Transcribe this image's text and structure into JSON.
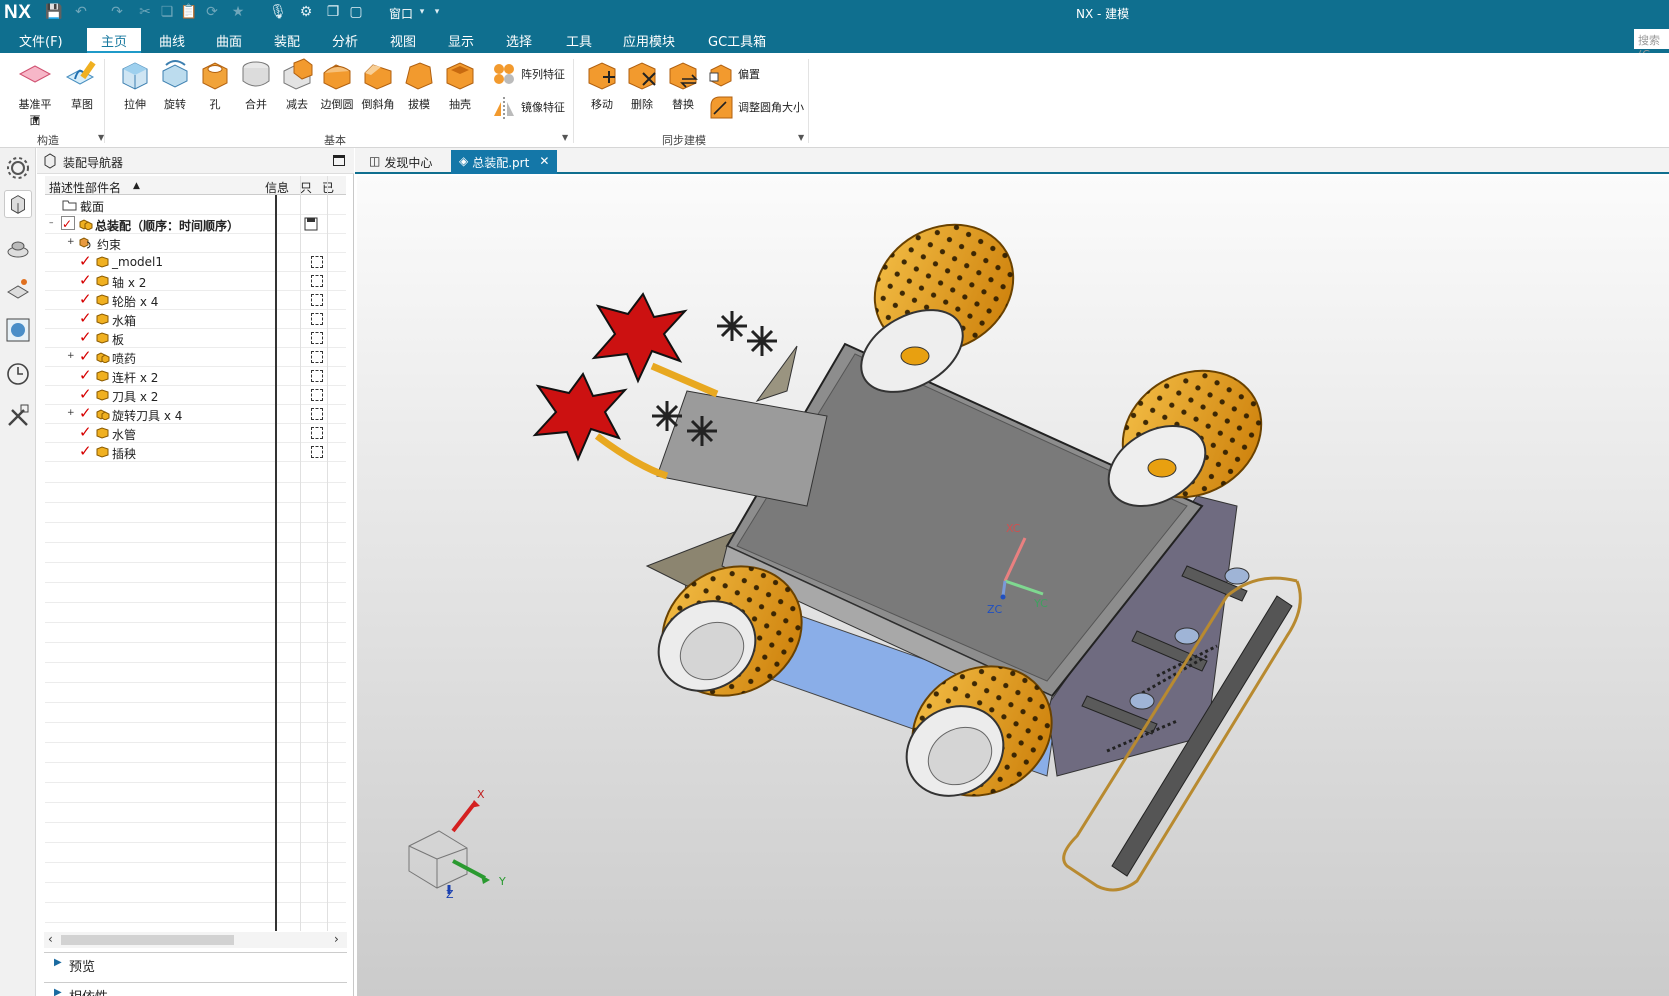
{
  "titlebar": {
    "logo": "NX",
    "window_menu": "窗口",
    "title": "NX - 建模"
  },
  "menubar": {
    "items": [
      "文件(F)",
      "主页",
      "曲线",
      "曲面",
      "装配",
      "分析",
      "视图",
      "显示",
      "选择",
      "工具",
      "应用模块",
      "GC工具箱"
    ],
    "active": "主页",
    "search_placeholder": "搜索 (C"
  },
  "ribbon": {
    "construct": {
      "datum_plane": "基准平面",
      "sketch": "草图",
      "group": "构造"
    },
    "basic": {
      "extrude": "拉伸",
      "revolve": "旋转",
      "hole": "孔",
      "unite": "合并",
      "subtract": "减去",
      "edge_blend": "边倒圆",
      "chamfer": "倒斜角",
      "draft": "拔模",
      "shell": "抽壳",
      "pattern_feature": "阵列特征",
      "mirror_feature": "镜像特征",
      "group": "基本"
    },
    "sync": {
      "move": "移动",
      "delete": "删除",
      "replace": "替换",
      "offset": "偏置",
      "resize_blend": "调整圆角大小",
      "group": "同步建模"
    }
  },
  "navigator": {
    "title": "装配导航器",
    "columns": {
      "name": "描述性部件名",
      "info": "信息",
      "readonly": "只",
      "extra": "已"
    },
    "rows": [
      {
        "label": "截面",
        "type": "folder"
      },
      {
        "label": "总装配（顺序：时间顺序）",
        "type": "root"
      },
      {
        "label": "约束",
        "type": "constraints"
      },
      {
        "label": "_model1"
      },
      {
        "label": "轴 x 2"
      },
      {
        "label": "轮胎 x 4"
      },
      {
        "label": "水箱"
      },
      {
        "label": "板"
      },
      {
        "label": "喷药",
        "expandable": true
      },
      {
        "label": "连杆 x 2"
      },
      {
        "label": "刀具 x 2"
      },
      {
        "label": "旋转刀具 x 4",
        "expandable": true
      },
      {
        "label": "水管"
      },
      {
        "label": "插秧"
      }
    ],
    "preview": "预览",
    "dependencies": "相依性"
  },
  "tabs": [
    {
      "label": "发现中心",
      "active": false
    },
    {
      "label": "总装配.prt",
      "active": true
    }
  ],
  "viewport": {
    "wcs": {
      "x": "XC",
      "y": "YC",
      "z": "ZC"
    },
    "triad": {
      "x": "X",
      "y": "Y",
      "z": "Z"
    }
  },
  "colors": {
    "titlebar": "#0f6f8f",
    "accent": "#1477a8",
    "tire": "#e8a010",
    "body": "#8a8a8a",
    "blade": "#cc1111"
  }
}
